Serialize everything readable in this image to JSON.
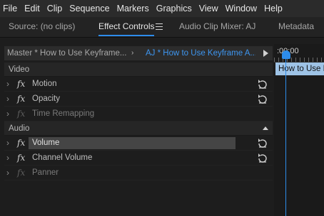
{
  "menubar": {
    "items": [
      "File",
      "Edit",
      "Clip",
      "Sequence",
      "Markers",
      "Graphics",
      "View",
      "Window",
      "Help"
    ]
  },
  "tabs": {
    "source": "Source: (no clips)",
    "effect_controls": "Effect Controls",
    "audio_clip_mixer": "Audio Clip Mixer: AJ",
    "metadata": "Metadata"
  },
  "source_row": {
    "master": "Master * How to Use Keyframe...",
    "clip": "AJ * How to Use Keyframe A..."
  },
  "timeline": {
    "time": ":00:00",
    "clip_label": "How to Use Ke"
  },
  "sections": {
    "video": "Video",
    "audio": "Audio"
  },
  "effects": {
    "motion": "Motion",
    "opacity": "Opacity",
    "time_remapping": "Time Remapping",
    "volume": "Volume",
    "channel_volume": "Channel Volume",
    "panner": "Panner",
    "fx": "fx"
  },
  "colors": {
    "accent": "#2d8ceb",
    "clip": "#9ec3e6",
    "background": "#1d1d1d"
  },
  "icons": {
    "reset": "reset-icon",
    "expand": "chevron-right-icon",
    "collapse": "triangle-up-icon",
    "play": "play-icon",
    "panel_menu": "hamburger-menu-icon"
  }
}
